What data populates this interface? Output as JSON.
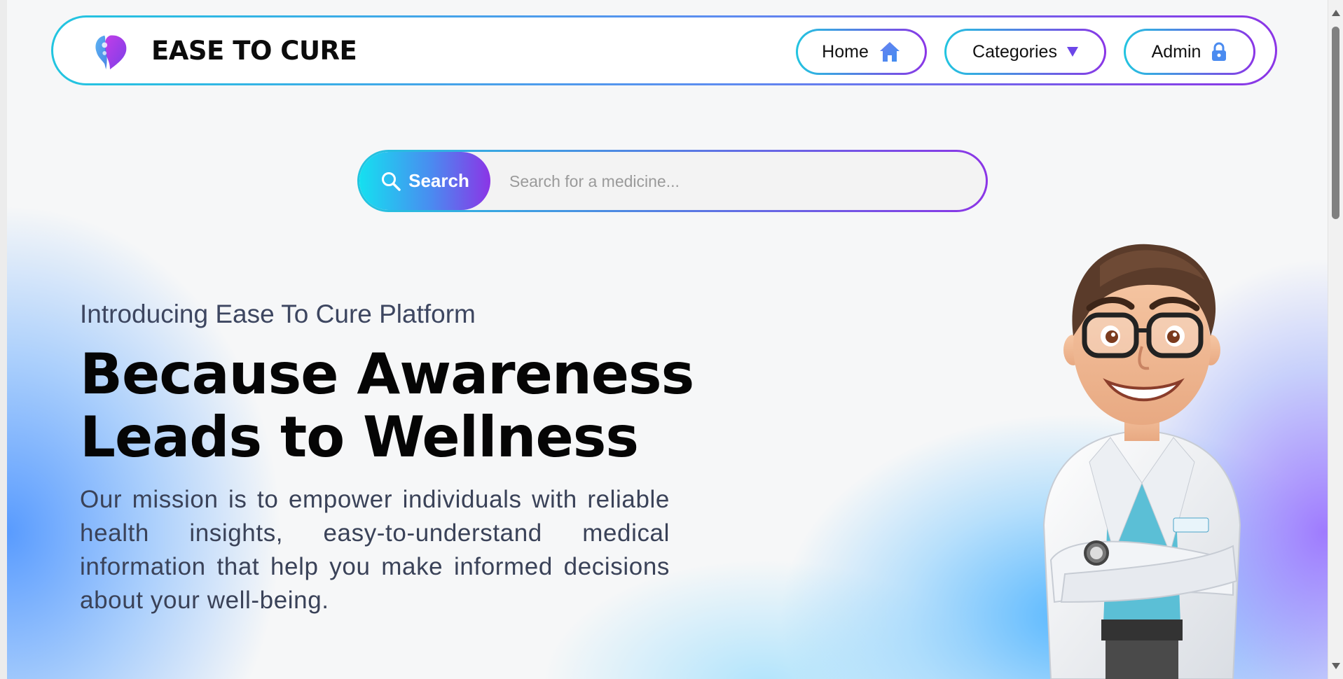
{
  "brand": {
    "name": "EASE TO CURE",
    "logo_icon": "head-heart-logo-icon"
  },
  "nav": {
    "home_label": "Home",
    "categories_label": "Categories",
    "admin_label": "Admin"
  },
  "search": {
    "button_label": "Search",
    "placeholder": "Search for a medicine..."
  },
  "hero": {
    "intro": "Introducing Ease To Cure Platform",
    "headline_line1": "Because Awareness",
    "headline_line2": "Leads to Wellness",
    "mission": "Our mission is to empower individuals with reliable health insights, easy-to-understand medical information that help you make informed decisions about your well-being."
  },
  "colors": {
    "gradient_start": "#22c5e0",
    "gradient_end": "#8b35e6",
    "accent_blue": "#4a8bf0"
  }
}
